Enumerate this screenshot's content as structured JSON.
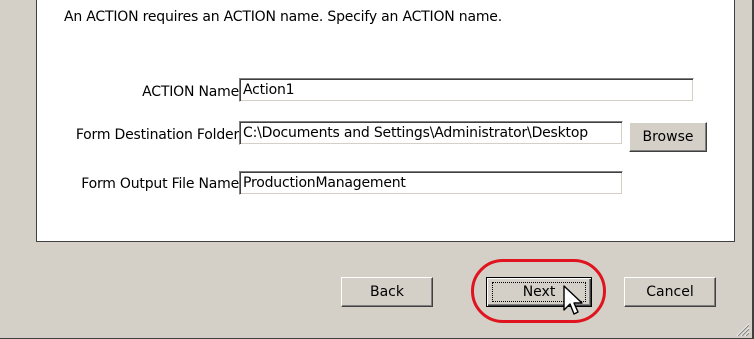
{
  "panel": {
    "instruction": "An ACTION requires an ACTION name. Specify an ACTION name."
  },
  "fields": {
    "action_name": {
      "label": "ACTION Name",
      "value": "Action1"
    },
    "destination_folder": {
      "label": "Form Destination Folder",
      "value": "C:\\Documents and Settings\\Administrator\\Desktop"
    },
    "output_file_name": {
      "label": "Form Output File Name",
      "value": "ProductionManagement"
    }
  },
  "buttons": {
    "browse": "Browse",
    "back": "Back",
    "next": "Next",
    "cancel": "Cancel"
  },
  "annotation": {
    "highlight_color": "#e0141e"
  },
  "icons": [
    "mouse-pointer-icon",
    "resize-grip-icon"
  ]
}
